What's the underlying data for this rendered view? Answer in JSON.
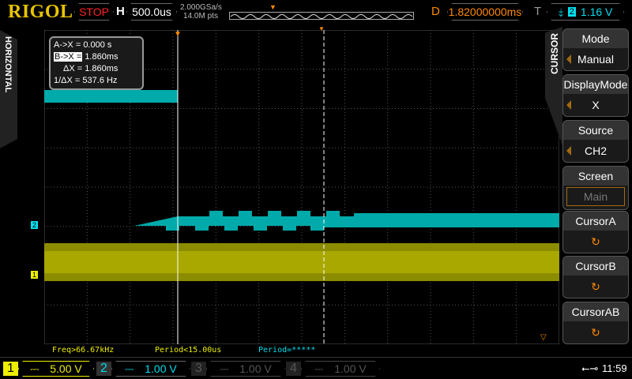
{
  "header": {
    "logo": "RIGOL",
    "run_state": "STOP",
    "h_label": "H",
    "timebase": "500.0us",
    "sample_rate": "2.000GSa/s",
    "memory_depth": "14.0M pts",
    "d_label": "D",
    "delay": "1.82000000ms",
    "t_label": "T",
    "trigger_source": "2",
    "trigger_level": "1.16 V"
  },
  "side_label_left": "HORIZONTAL",
  "cursor_readout": {
    "a_label": "A->X =",
    "a_value": "0.000 s",
    "b_label": "B->X =",
    "b_value": "1.860ms",
    "dx_label": "ΔX =",
    "dx_value": "1.860ms",
    "inv_label": "1/ΔX =",
    "inv_value": "537.6 Hz"
  },
  "menu": {
    "title": "CURSOR",
    "items": [
      {
        "title": "Mode",
        "value": "Manual"
      },
      {
        "title": "DisplayMode",
        "value": "X"
      },
      {
        "title": "Source",
        "value": "CH2"
      },
      {
        "title": "Screen",
        "value": "Main"
      },
      {
        "title": "CursorA",
        "value": "↻"
      },
      {
        "title": "CursorB",
        "value": "↻"
      },
      {
        "title": "CursorAB",
        "value": "↻"
      }
    ]
  },
  "measurements": [
    "Freq>66.67kHz",
    "Period<15.00us",
    "Period=*****"
  ],
  "channels": [
    {
      "num": "1",
      "coupling": "⎓",
      "scale": "5.00 V",
      "color": "#e8e800"
    },
    {
      "num": "2",
      "coupling": "⎓",
      "scale": "1.00 V",
      "color": "#00d8e8"
    },
    {
      "num": "3",
      "coupling": "⎓",
      "scale": "1.00 V",
      "color": "#555555"
    },
    {
      "num": "4",
      "coupling": "⎓",
      "scale": "1.00 V",
      "color": "#555555"
    }
  ],
  "markers": {
    "ch1": "1",
    "ch2": "2"
  },
  "status": {
    "usb_icon": "usb-icon",
    "time": "11:59"
  }
}
